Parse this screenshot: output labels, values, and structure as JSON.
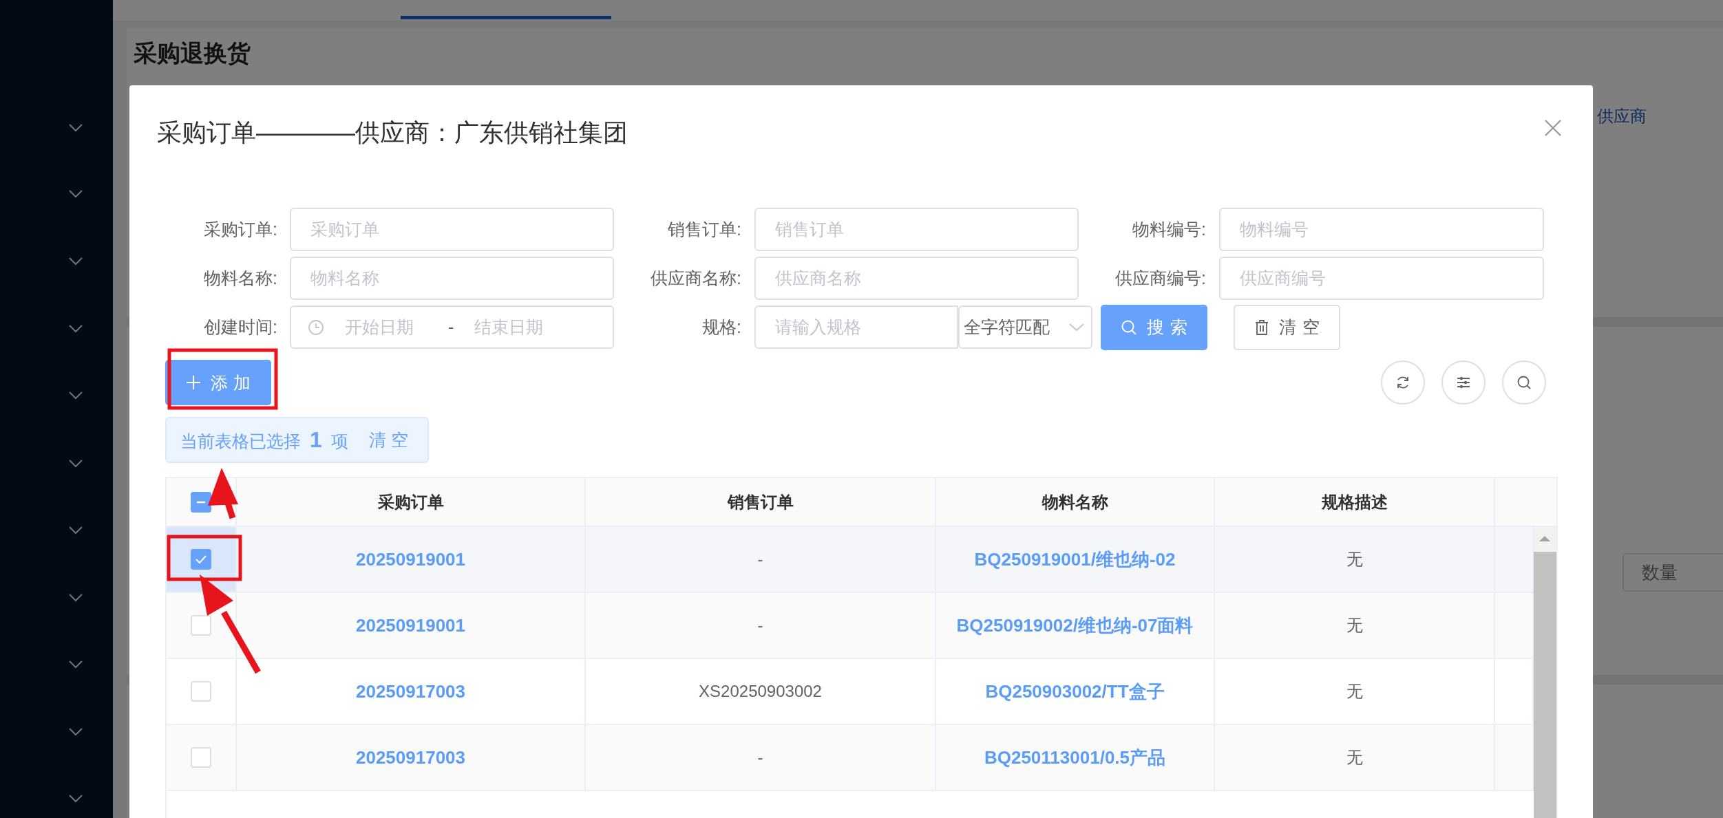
{
  "page": {
    "title": "采购退换货",
    "supplier_link": "供应商",
    "quantity_placeholder": "数量"
  },
  "dialog": {
    "title": "采购订单————供应商：广东供销社集团",
    "filters": [
      {
        "kind": "text",
        "label": "采购订单:",
        "placeholder": "采购订单"
      },
      {
        "kind": "text",
        "label": "销售订单:",
        "placeholder": "销售订单"
      },
      {
        "kind": "text",
        "label": "物料编号:",
        "placeholder": "物料编号"
      },
      {
        "kind": "text",
        "label": "物料名称:",
        "placeholder": "物料名称"
      },
      {
        "kind": "text",
        "label": "供应商名称:",
        "placeholder": "供应商名称"
      },
      {
        "kind": "text",
        "label": "供应商编号:",
        "placeholder": "供应商编号"
      },
      {
        "kind": "daterange",
        "label": "创建时间:",
        "start_placeholder": "开始日期",
        "separator": "-",
        "end_placeholder": "结束日期"
      },
      {
        "kind": "match",
        "label": "规格:",
        "placeholder": "请输入规格",
        "mode": "全字符匹配"
      }
    ],
    "search_button": "搜索",
    "clear_button": "清空",
    "add_button": "添加",
    "selection": {
      "text": "当前表格已选择 **1** 项",
      "clear_link": "清空"
    },
    "table": {
      "select_all": {
        "indeterminate": true
      },
      "columns": [
        "采购订单",
        "销售订单",
        "物料名称",
        "规格描述"
      ],
      "rows": [
        {
          "selected": true,
          "purchase_order": "20250919001",
          "sales_order": "-",
          "material": "BQ250919001/维也纳-02",
          "spec": "无"
        },
        {
          "selected": false,
          "purchase_order": "20250919001",
          "sales_order": "-",
          "material": "BQ250919002/维也纳-07面料",
          "spec": "无"
        },
        {
          "selected": false,
          "purchase_order": "20250917003",
          "sales_order": "XS20250903002",
          "material": "BQ250903002/TT盒子",
          "spec": "无"
        },
        {
          "selected": false,
          "purchase_order": "20250917003",
          "sales_order": "-",
          "material": "BQ250113001/0.5产品",
          "spec": "无"
        }
      ]
    }
  }
}
